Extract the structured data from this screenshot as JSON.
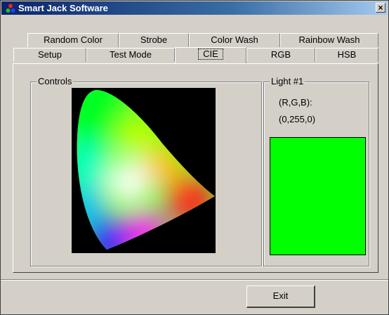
{
  "window": {
    "title": "Smart Jack Software",
    "close_glyph": "×"
  },
  "tabs_row1": [
    {
      "label": "Random Color"
    },
    {
      "label": "Strobe"
    },
    {
      "label": "Color Wash"
    },
    {
      "label": "Rainbow Wash"
    }
  ],
  "tabs_row2": [
    {
      "label": "Setup"
    },
    {
      "label": "Test Mode"
    },
    {
      "label": "CIE",
      "active": true
    },
    {
      "label": "RGB"
    },
    {
      "label": "HSB"
    }
  ],
  "controls": {
    "label": "Controls"
  },
  "light": {
    "label": "Light #1",
    "rgb_label": "(R,G,B):",
    "rgb_value": "(0,255,0)",
    "color": "#00ff00"
  },
  "exit_label": "Exit",
  "icons": {
    "app": "app-icon",
    "close": "close-icon"
  }
}
